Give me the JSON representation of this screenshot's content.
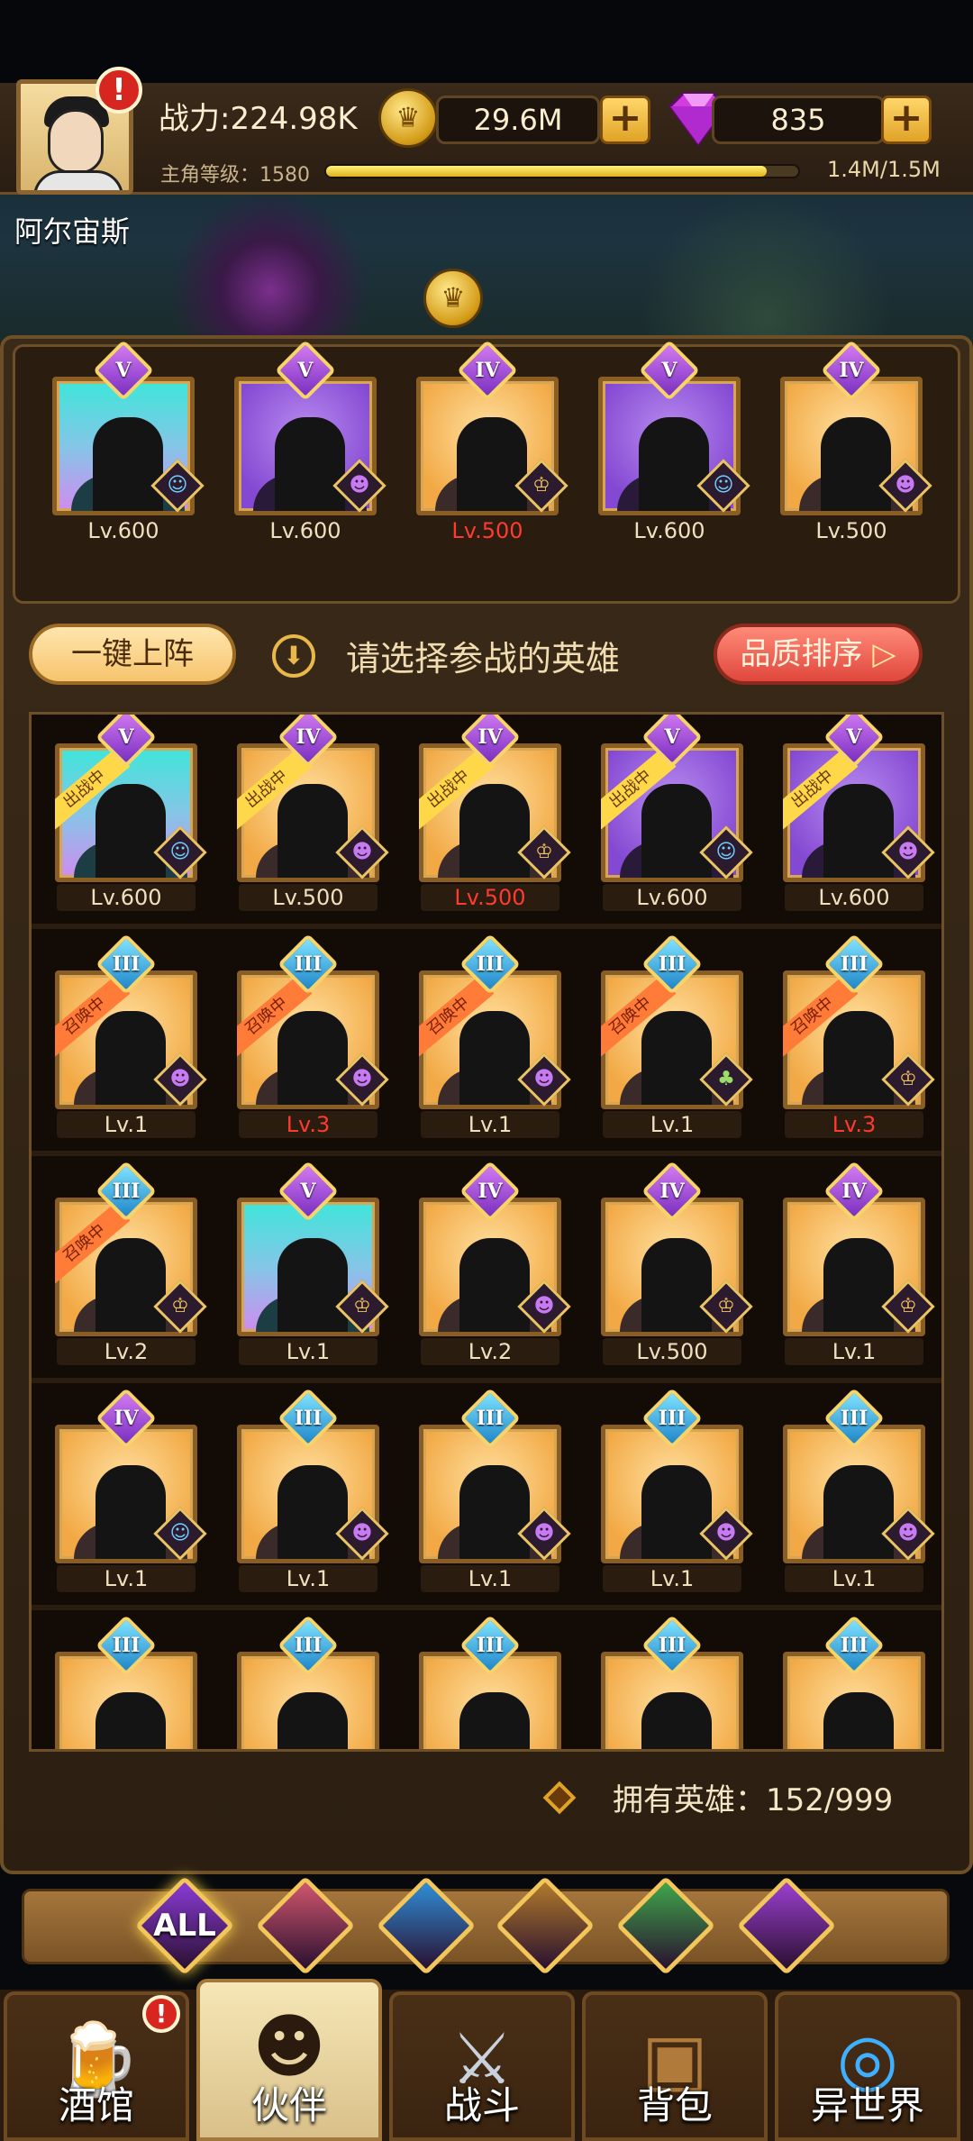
{
  "player": {
    "power": "战力:224.98K",
    "level_label": "主角等级：1580",
    "xp_text": "1.4M/1.5M",
    "xp_fraction": 0.933,
    "name": "阿尔宙斯"
  },
  "resources": {
    "gold": "29.6M",
    "gems": "835"
  },
  "team": [
    {
      "rank": "V",
      "level": "Lv.600",
      "level_red": false,
      "bg": "teal",
      "faction": "blue"
    },
    {
      "rank": "V",
      "level": "Lv.600",
      "level_red": false,
      "bg": "purple",
      "faction": "purple"
    },
    {
      "rank": "IV",
      "level": "Lv.500",
      "level_red": true,
      "bg": "orange",
      "faction": "gold"
    },
    {
      "rank": "V",
      "level": "Lv.600",
      "level_red": false,
      "bg": "purple",
      "faction": "blue"
    },
    {
      "rank": "IV",
      "level": "Lv.500",
      "level_red": false,
      "bg": "orange",
      "faction": "purple"
    }
  ],
  "toolbar": {
    "auto_deploy": "一键上阵",
    "hint": "请选择参战的英雄",
    "sort": "品质排序"
  },
  "tags": {
    "deployed": "出战中",
    "summoning": "召唤中"
  },
  "roster": [
    [
      {
        "rank": "V",
        "level": "Lv.600",
        "level_red": false,
        "bg": "teal",
        "faction": "blue",
        "tag": "deployed"
      },
      {
        "rank": "IV",
        "level": "Lv.500",
        "level_red": false,
        "bg": "orange",
        "faction": "purple",
        "tag": "deployed"
      },
      {
        "rank": "IV",
        "level": "Lv.500",
        "level_red": true,
        "bg": "orange",
        "faction": "gold",
        "tag": "deployed"
      },
      {
        "rank": "V",
        "level": "Lv.600",
        "level_red": false,
        "bg": "purple",
        "faction": "blue",
        "tag": "deployed"
      },
      {
        "rank": "V",
        "level": "Lv.600",
        "level_red": false,
        "bg": "purple",
        "faction": "purple",
        "tag": "deployed"
      }
    ],
    [
      {
        "rank": "III",
        "level": "Lv.1",
        "level_red": false,
        "bg": "orange",
        "faction": "purple",
        "tag": "summoning"
      },
      {
        "rank": "III",
        "level": "Lv.3",
        "level_red": true,
        "bg": "orange",
        "faction": "purple",
        "tag": "summoning"
      },
      {
        "rank": "III",
        "level": "Lv.1",
        "level_red": false,
        "bg": "orange",
        "faction": "purple",
        "tag": "summoning"
      },
      {
        "rank": "III",
        "level": "Lv.1",
        "level_red": false,
        "bg": "orange",
        "faction": "green",
        "tag": "summoning"
      },
      {
        "rank": "III",
        "level": "Lv.3",
        "level_red": true,
        "bg": "orange",
        "faction": "gold",
        "tag": "summoning"
      }
    ],
    [
      {
        "rank": "III",
        "level": "Lv.2",
        "level_red": false,
        "bg": "orange",
        "faction": "gold",
        "tag": "summoning"
      },
      {
        "rank": "V",
        "level": "Lv.1",
        "level_red": false,
        "bg": "teal",
        "faction": "gold",
        "tag": ""
      },
      {
        "rank": "IV",
        "level": "Lv.2",
        "level_red": false,
        "bg": "orange",
        "faction": "purple",
        "tag": ""
      },
      {
        "rank": "IV",
        "level": "Lv.500",
        "level_red": false,
        "bg": "orange",
        "faction": "gold",
        "tag": ""
      },
      {
        "rank": "IV",
        "level": "Lv.1",
        "level_red": false,
        "bg": "orange",
        "faction": "gold",
        "tag": ""
      }
    ],
    [
      {
        "rank": "IV",
        "level": "Lv.1",
        "level_red": false,
        "bg": "orange",
        "faction": "blue",
        "tag": ""
      },
      {
        "rank": "III",
        "level": "Lv.1",
        "level_red": false,
        "bg": "orange",
        "faction": "purple",
        "tag": ""
      },
      {
        "rank": "III",
        "level": "Lv.1",
        "level_red": false,
        "bg": "orange",
        "faction": "purple",
        "tag": ""
      },
      {
        "rank": "III",
        "level": "Lv.1",
        "level_red": false,
        "bg": "orange",
        "faction": "purple",
        "tag": ""
      },
      {
        "rank": "III",
        "level": "Lv.1",
        "level_red": false,
        "bg": "orange",
        "faction": "purple",
        "tag": ""
      }
    ],
    [
      {
        "rank": "III",
        "level": "",
        "level_red": false,
        "bg": "orange",
        "faction": "",
        "tag": ""
      },
      {
        "rank": "III",
        "level": "",
        "level_red": false,
        "bg": "orange",
        "faction": "",
        "tag": ""
      },
      {
        "rank": "III",
        "level": "",
        "level_red": false,
        "bg": "orange",
        "faction": "",
        "tag": ""
      },
      {
        "rank": "III",
        "level": "",
        "level_red": false,
        "bg": "orange",
        "faction": "",
        "tag": ""
      },
      {
        "rank": "III",
        "level": "",
        "level_red": false,
        "bg": "orange",
        "faction": "",
        "tag": ""
      }
    ]
  ],
  "owned": "拥有英雄：152/999",
  "filters": [
    {
      "label": "ALL",
      "icon": "all-filter-icon",
      "color": "#8a3bd6"
    },
    {
      "label": "",
      "icon": "warrior-faction-icon",
      "color": "#d0566e"
    },
    {
      "label": "",
      "icon": "merfolk-faction-icon",
      "color": "#2f8ed6"
    },
    {
      "label": "",
      "icon": "beast-faction-icon",
      "color": "#b07a2a"
    },
    {
      "label": "",
      "icon": "elf-faction-icon",
      "color": "#3fa64a"
    },
    {
      "label": "",
      "icon": "demon-faction-icon",
      "color": "#9b3fd0"
    }
  ],
  "nav": [
    {
      "label": "酒馆",
      "icon": "tavern-mug-icon",
      "active": false,
      "alert": true
    },
    {
      "label": "伙伴",
      "icon": "partner-face-icon",
      "active": true,
      "alert": false
    },
    {
      "label": "战斗",
      "icon": "crossed-swords-icon",
      "active": false,
      "alert": false
    },
    {
      "label": "背包",
      "icon": "backpack-icon",
      "active": false,
      "alert": false
    },
    {
      "label": "异世界",
      "icon": "portal-icon",
      "active": false,
      "alert": false
    }
  ],
  "colors": {
    "deployed_ribbon": "#ffd84a",
    "summoning_ribbon": "#ff7b38",
    "level_red": "#ff3b30"
  }
}
